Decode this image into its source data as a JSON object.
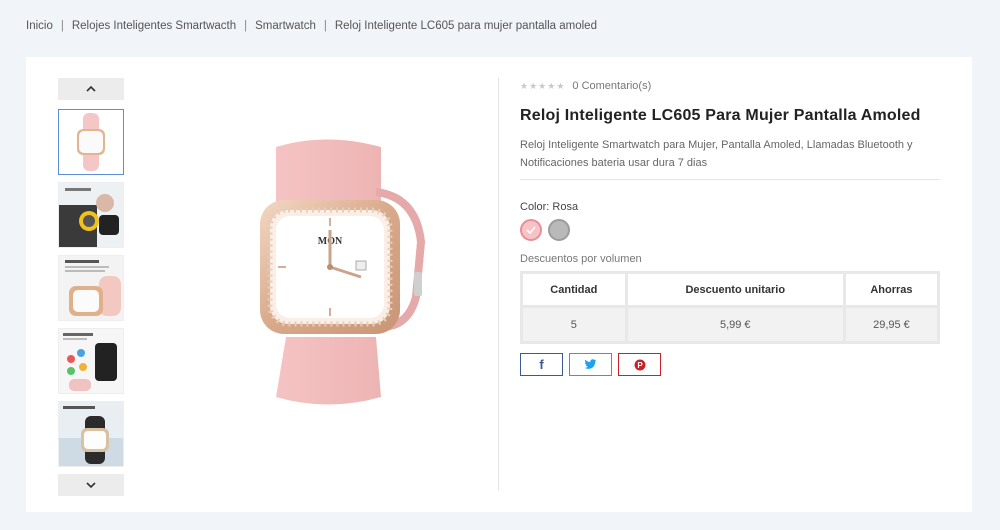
{
  "breadcrumb": {
    "items": [
      "Inicio",
      "Relojes Inteligentes Smartwacth",
      "Smartwatch",
      "Reloj Inteligente LC605 para mujer pantalla amoled"
    ],
    "separator": "|"
  },
  "gallery": {
    "thumbnail_count": 5,
    "active_index": 0,
    "up_icon": "chevron-up-icon",
    "down_icon": "chevron-down-icon"
  },
  "watch_face": {
    "day_label": "MON"
  },
  "product": {
    "rating_stars": 0,
    "comments_label": "0 Comentario(s)",
    "title": "Reloj Inteligente LC605 Para Mujer Pantalla Amoled",
    "description": "Reloj Inteligente Smartwatch para Mujer, Pantalla Amoled, Llamadas Bluetooth y Notificaciones bateria usar dura 7 dias",
    "color_label": "Color: Rosa",
    "colors": [
      {
        "name": "Rosa",
        "hex": "#f7c3c7",
        "selected": true
      },
      {
        "name": "Gris",
        "hex": "#b9b9b9",
        "selected": false
      }
    ]
  },
  "volume_discounts": {
    "label": "Descuentos por volumen",
    "headers": [
      "Cantidad",
      "Descuento unitario",
      "Ahorras"
    ],
    "rows": [
      [
        "5",
        "5,99 €",
        "29,95 €"
      ]
    ]
  },
  "share": {
    "buttons": [
      {
        "name": "facebook",
        "icon": "facebook-icon",
        "glyph": "f",
        "color": "#3b5998"
      },
      {
        "name": "twitter",
        "icon": "twitter-icon",
        "color": "#1da1f2"
      },
      {
        "name": "pinterest",
        "icon": "pinterest-icon",
        "glyph": "P",
        "color": "#cb2027"
      }
    ]
  }
}
